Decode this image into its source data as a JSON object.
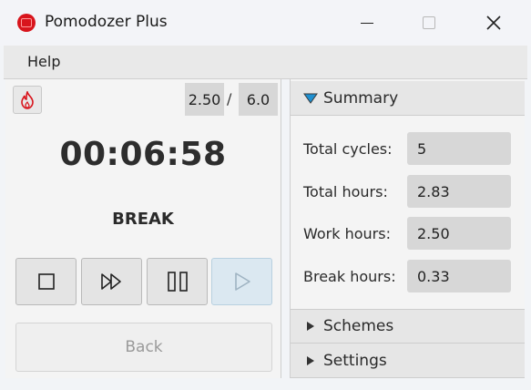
{
  "window": {
    "title": "Pomodozer Plus",
    "icons": {
      "app": "tomato-icon",
      "minimize": "minimize-icon",
      "maximize": "maximize-icon",
      "close": "close-icon"
    }
  },
  "menu": {
    "items": [
      "Help"
    ]
  },
  "timer": {
    "hours_current": "2.50",
    "hours_separator": "/",
    "hours_target": "6.0",
    "time": "00:06:58",
    "phase": "BREAK",
    "controls": [
      "stop-icon",
      "skip-icon",
      "pause-icon",
      "play-icon"
    ],
    "back_label": "Back",
    "accent_color": "#d8141c",
    "play_bg": "#dbe8f1"
  },
  "panels": {
    "summary": {
      "label": "Summary",
      "expanded": true,
      "rows": [
        {
          "label": "Total cycles:",
          "value": "5"
        },
        {
          "label": "Total hours:",
          "value": "2.83"
        },
        {
          "label": "Work hours:",
          "value": "2.50"
        },
        {
          "label": "Break hours:",
          "value": "0.33"
        }
      ]
    },
    "schemes": {
      "label": "Schemes",
      "expanded": false
    },
    "settings": {
      "label": "Settings",
      "expanded": false
    }
  }
}
